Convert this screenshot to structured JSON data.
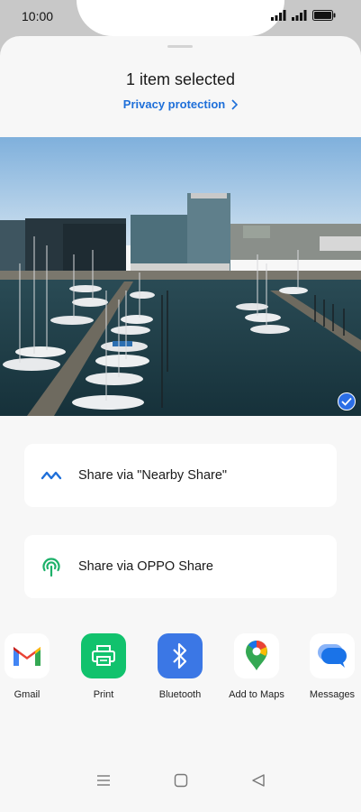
{
  "status": {
    "time": "10:00"
  },
  "sheet": {
    "title": "1 item selected",
    "privacy_link": "Privacy protection"
  },
  "share_options": {
    "nearby": "Share via \"Nearby Share\"",
    "oppo": "Share via OPPO Share"
  },
  "apps": [
    {
      "name": "Gmail",
      "icon": "gmail-icon"
    },
    {
      "name": "Print",
      "icon": "print-icon"
    },
    {
      "name": "Bluetooth",
      "icon": "bluetooth-icon"
    },
    {
      "name": "Add to Maps",
      "icon": "maps-pin-icon"
    },
    {
      "name": "Messages",
      "icon": "messages-icon"
    }
  ],
  "colors": {
    "accent": "#1e6fd9",
    "print_tile": "#11c26d",
    "bluetooth_tile": "#3b77e5",
    "oppo_share": "#1db16a"
  }
}
